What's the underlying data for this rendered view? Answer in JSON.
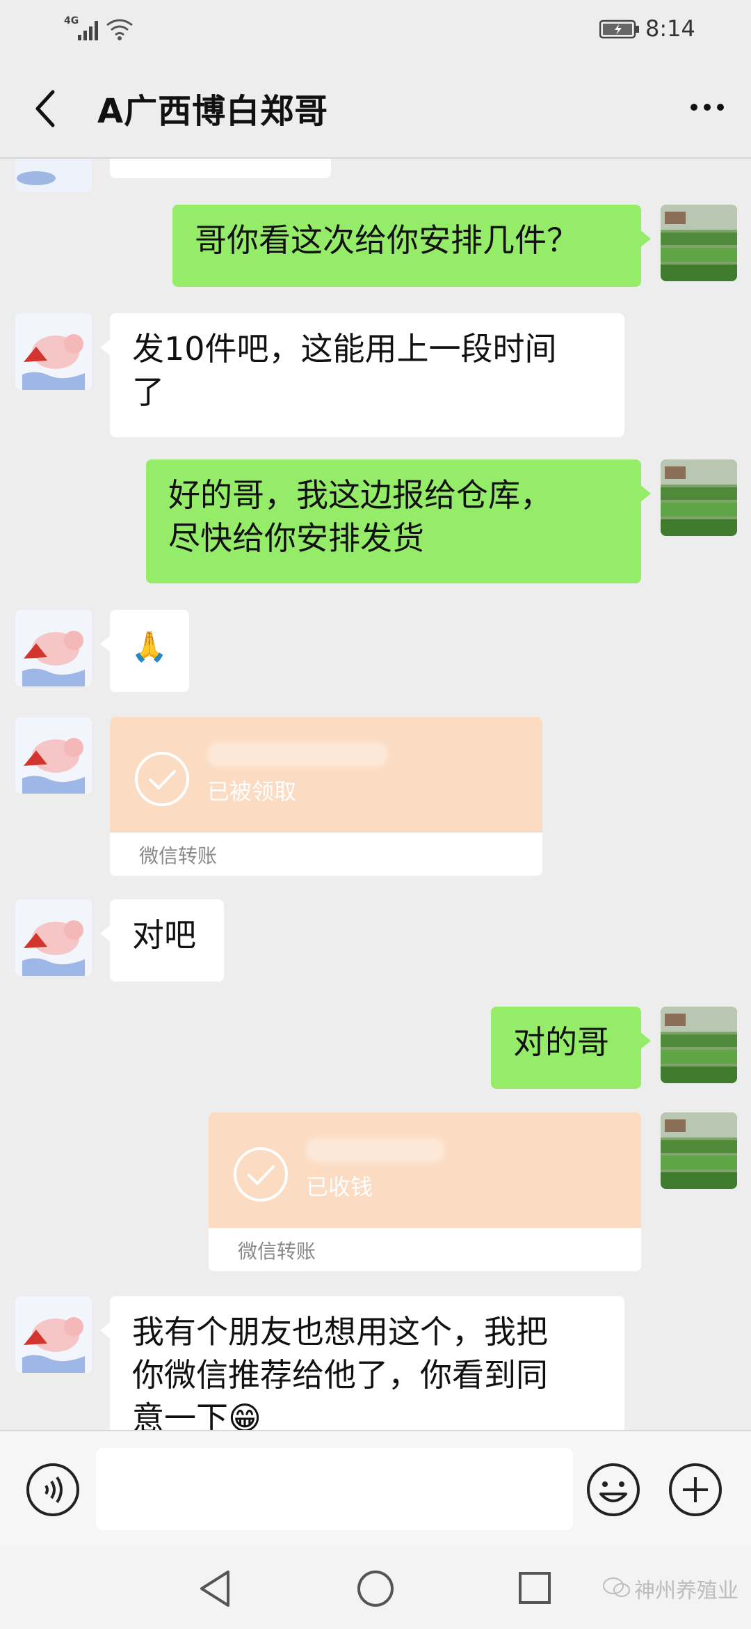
{
  "status_bar": {
    "network": "4G",
    "time": "8:14",
    "icons": [
      "signal-icon",
      "wifi-icon",
      "battery-icon"
    ]
  },
  "header": {
    "title": "A广西博白郑哥",
    "back_icon": "chevron-left-icon",
    "more_icon": "more-dots-icon"
  },
  "messages": [
    {
      "dir": "out",
      "type": "text",
      "text": "哥你看这次给你安排几件？"
    },
    {
      "dir": "in",
      "type": "text",
      "line1": "发10件吧，这能用上一段时间",
      "line2": "了"
    },
    {
      "dir": "out",
      "type": "text",
      "line1": "好的哥，我这边报给仓库，",
      "line2": "尽快给你安排发货"
    },
    {
      "dir": "in",
      "type": "emoji",
      "emoji": "🙏"
    },
    {
      "dir": "in",
      "type": "transfer",
      "status": "已被领取",
      "label": "微信转账"
    },
    {
      "dir": "in",
      "type": "text",
      "text": "对吧"
    },
    {
      "dir": "out",
      "type": "text",
      "text": "对的哥"
    },
    {
      "dir": "out",
      "type": "transfer",
      "status": "已收钱",
      "label": "微信转账"
    },
    {
      "dir": "in",
      "type": "text",
      "line1": "我有个朋友也想用这个，我把",
      "line2": "你微信推荐给他了，你看到同",
      "line3": "意一下😁"
    }
  ],
  "input_bar": {
    "voice_icon": "voice-icon",
    "emoji_icon": "smiley-icon",
    "plus_icon": "plus-icon",
    "value": ""
  },
  "nav_bar": {
    "icons": [
      "nav-back-icon",
      "nav-home-icon",
      "nav-recent-icon"
    ]
  },
  "watermark": {
    "text": "神州养殖业"
  },
  "colors": {
    "background": "#ededed",
    "bubble_out": "#95ec69",
    "bubble_in": "#ffffff",
    "transfer": "#fbdcc3"
  }
}
